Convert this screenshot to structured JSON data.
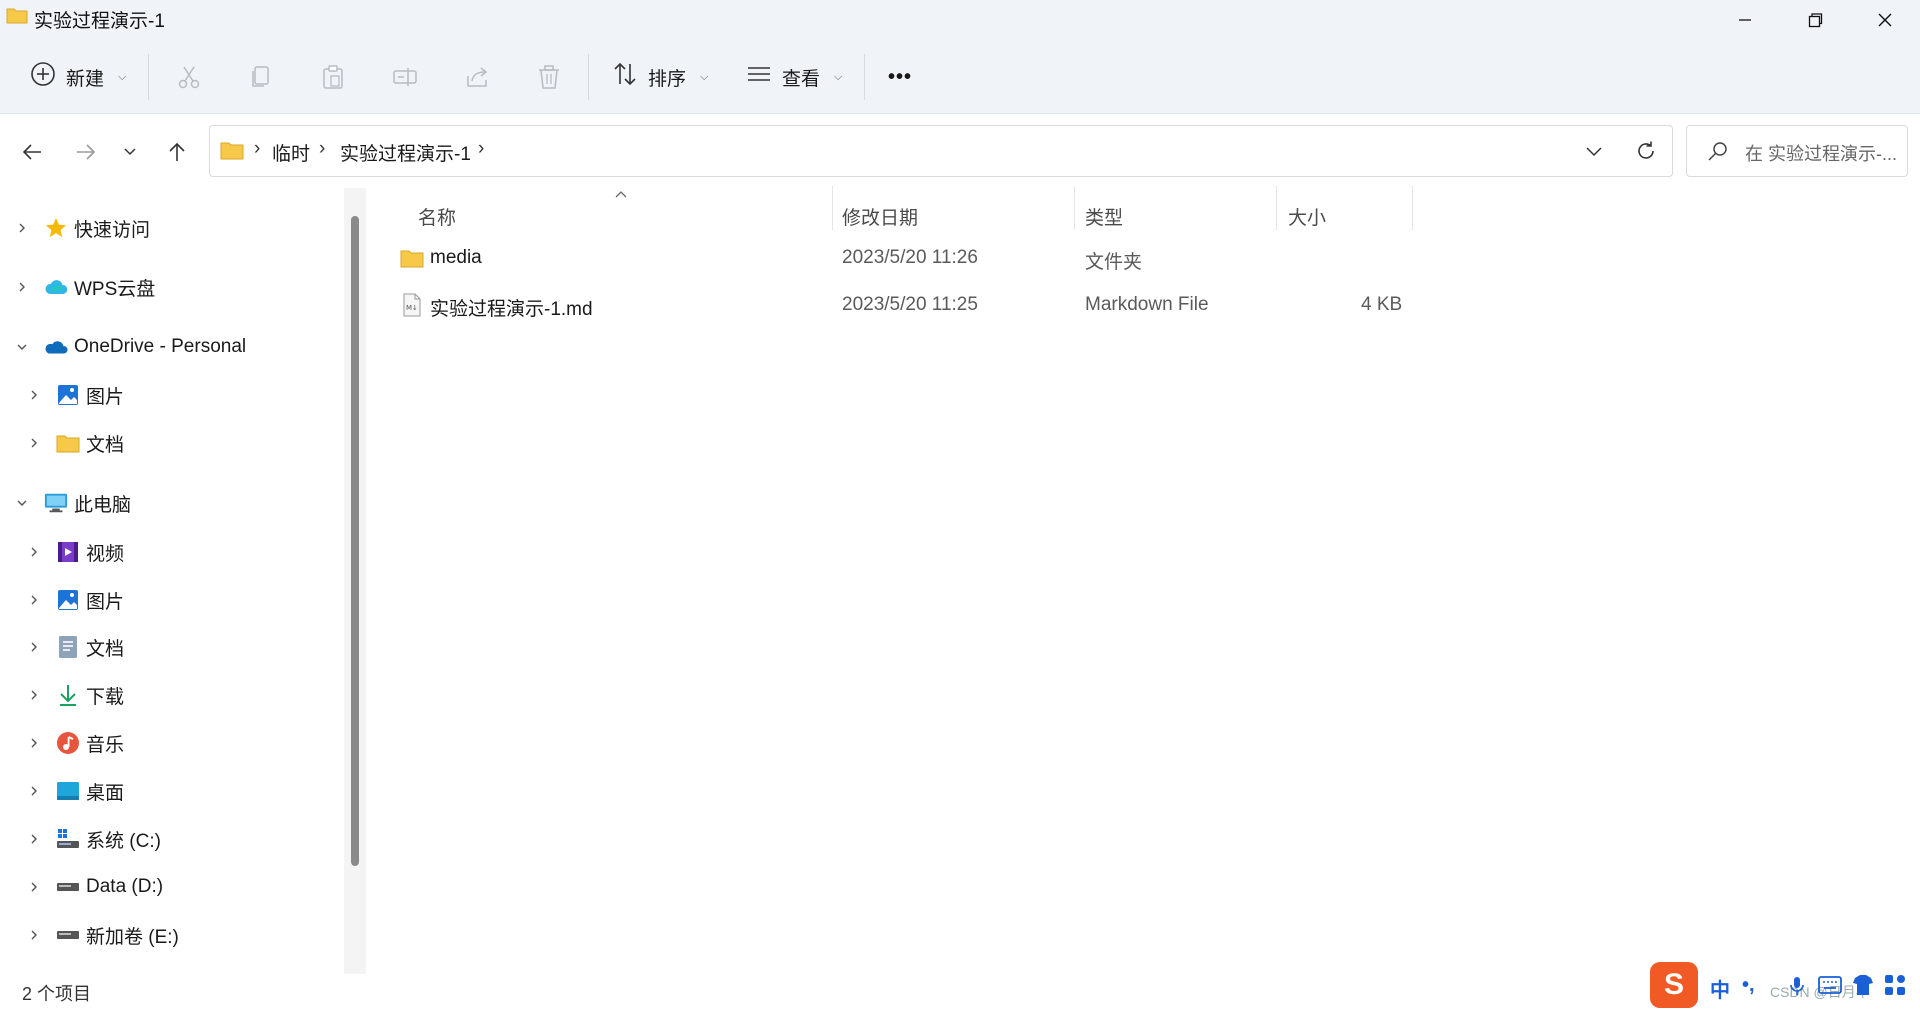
{
  "window": {
    "title": "实验过程演示-1",
    "controls": [
      "minimize",
      "maximize",
      "close"
    ]
  },
  "toolbar": {
    "new_label": "新建",
    "sort_label": "排序",
    "view_label": "查看",
    "more_label": "•••",
    "icons": [
      "plus-circle-icon",
      "cut-icon",
      "copy-icon",
      "paste-icon",
      "rename-icon",
      "share-icon",
      "delete-icon"
    ]
  },
  "address": {
    "crumbs": [
      "临时",
      "实验过程演示-1"
    ],
    "search_placeholder": "在 实验过程演示-..."
  },
  "sidebar": {
    "groups": [
      {
        "label": "快速访问",
        "icon": "star-icon",
        "expanded": false
      },
      {
        "label": "WPS云盘",
        "icon": "cloud-icon",
        "expanded": false
      },
      {
        "label": "OneDrive - Personal",
        "icon": "onedrive-icon",
        "expanded": true,
        "children": [
          {
            "label": "图片",
            "icon": "pictures-icon"
          },
          {
            "label": "文档",
            "icon": "folder-icon"
          }
        ]
      },
      {
        "label": "此电脑",
        "icon": "computer-icon",
        "expanded": true,
        "children": [
          {
            "label": "视频",
            "icon": "video-icon"
          },
          {
            "label": "图片",
            "icon": "pictures-icon"
          },
          {
            "label": "文档",
            "icon": "documents-icon"
          },
          {
            "label": "下载",
            "icon": "download-icon"
          },
          {
            "label": "音乐",
            "icon": "music-icon"
          },
          {
            "label": "桌面",
            "icon": "desktop-icon"
          },
          {
            "label": "系统 (C:)",
            "icon": "system-drive-icon"
          },
          {
            "label": "Data (D:)",
            "icon": "drive-icon"
          },
          {
            "label": "新加卷 (E:)",
            "icon": "drive-icon"
          }
        ]
      }
    ]
  },
  "columns": {
    "name": "名称",
    "date": "修改日期",
    "type": "类型",
    "size": "大小"
  },
  "files": [
    {
      "name": "media",
      "date": "2023/5/20 11:26",
      "type": "文件夹",
      "size": "",
      "icon": "folder-icon"
    },
    {
      "name": "实验过程演示-1.md",
      "date": "2023/5/20 11:25",
      "type": "Markdown File",
      "size": "4 KB",
      "icon": "markdown-file-icon"
    }
  ],
  "status": {
    "item_count": "2 个项目"
  },
  "ime": {
    "logo": "S",
    "mode": "中",
    "punct": "•,",
    "watermark": "CSDN @日月半"
  },
  "colors": {
    "chrome_bg": "#f0f4f9",
    "folder_yellow": "#f7c948",
    "accent_blue": "#1a73e8"
  }
}
